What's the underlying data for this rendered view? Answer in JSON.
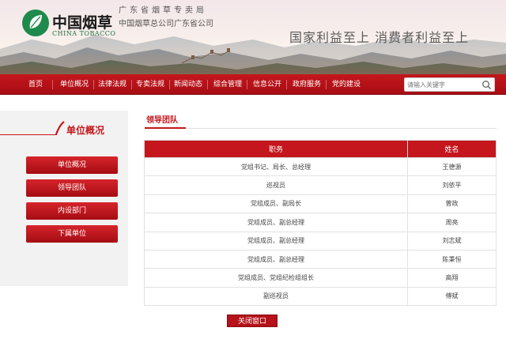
{
  "header": {
    "brand_cn": "中国烟草",
    "brand_en": "CHINA TOBACCO",
    "bureau": "广东省烟草专卖局",
    "company": "中国烟草总公司广东省公司",
    "slogan": "国家利益至上 消费者利益至上",
    "logo_icon": "tobacco-leaf-logo"
  },
  "nav": {
    "items": [
      "首页",
      "单位概况",
      "法律法规",
      "专卖法规",
      "新闻动态",
      "综合管理",
      "信息公开",
      "政府服务",
      "党的建设"
    ],
    "search_placeholder": "请输入关键字",
    "search_icon": "search-icon"
  },
  "sidebar": {
    "title": "单位概况",
    "items": [
      "单位概况",
      "领导团队",
      "内设部门",
      "下属单位"
    ]
  },
  "main": {
    "title": "领导团队",
    "columns": [
      "职务",
      "姓名"
    ],
    "rows": [
      [
        "党组书记、局长、总经理",
        "王德源"
      ],
      [
        "巡视员",
        "刘依平"
      ],
      [
        "党组成员、副局长",
        "曾政"
      ],
      [
        "党组成员、副总经理",
        "周亮"
      ],
      [
        "党组成员、副总经理",
        "刘志斌"
      ],
      [
        "党组成员、副总经理",
        "陈秉恒"
      ],
      [
        "党组成员、党组纪检组组长",
        "高翔"
      ],
      [
        "副巡视员",
        "傅斌"
      ]
    ],
    "close_label": "关闭窗口"
  },
  "colors": {
    "brand_red": "#c4161c",
    "brand_green": "#1e8a4c"
  }
}
